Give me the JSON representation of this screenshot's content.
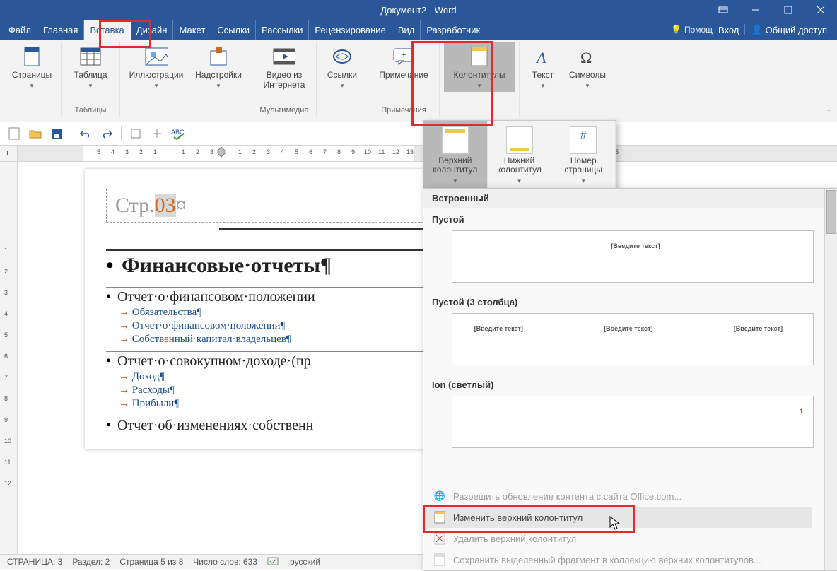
{
  "title": "Документ2 - Word",
  "tabs": {
    "file": "Файл",
    "home": "Главная",
    "insert": "Вставка",
    "design": "Дизайн",
    "layout": "Макет",
    "references": "Ссылки",
    "mailings": "Рассылки",
    "review": "Рецензирование",
    "view": "Вид",
    "developer": "Разработчик"
  },
  "help_placeholder": "Помощ",
  "signin": "Вход",
  "share": "Общий доступ",
  "ribbon": {
    "pages": "Страницы",
    "table": "Таблица",
    "tables_group": "Таблицы",
    "illustrations": "Иллюстрации",
    "addins": "Надстройки",
    "video": "Видео из Интернета",
    "media_group": "Мультимедиа",
    "links": "Ссылки",
    "comment": "Примечание",
    "comments_group": "Примечания",
    "headerfooter": "Колонтитулы",
    "text": "Текст",
    "symbols": "Символы"
  },
  "hf_popup": {
    "header": "Верхний колонтитул",
    "footer": "Нижний колонтитул",
    "pagenum": "Номер страницы"
  },
  "gallery": {
    "builtin": "Встроенный",
    "blank": "Пустой",
    "blank3": "Пустой (3 столбца)",
    "ion_light": "Ion (светлый)",
    "placeholder": "[Введите текст]",
    "menu_office": "Разрешить обновление контента с сайта Office.com...",
    "menu_edit_pre": "Изменить ",
    "menu_edit_accel": "в",
    "menu_edit_post": "ерхний колонтитул",
    "menu_remove": "Удалить верхний колонтитул",
    "menu_save": "Сохранить выделенный фрагмент в коллекцию верхних колонтитулов..."
  },
  "doc": {
    "header_left": "Стр.",
    "header_num": "03",
    "header_mark": "¤",
    "h1": "Финансовые·отчеты¶",
    "h2a": "Отчет·о·финансовом·положении",
    "toc1": "Обязательства¶",
    "toc2": "Отчет·о·финансовом·положении¶",
    "toc3": "Собственный·капитал·владельцев¶",
    "h2b": "Отчет·о·совокупном·доходе·(пр",
    "toc4": "Доход¶",
    "toc5": "Расходы¶",
    "toc6": "Прибыли¶",
    "h2c": "Отчет·об·изменениях·собственн"
  },
  "status": {
    "page": "СТРАНИЦА: 3",
    "section": "Раздел: 2",
    "pages": "Страница 5 из 8",
    "words": "Число слов: 633",
    "lang": "русский"
  },
  "ruler_corner": "L"
}
